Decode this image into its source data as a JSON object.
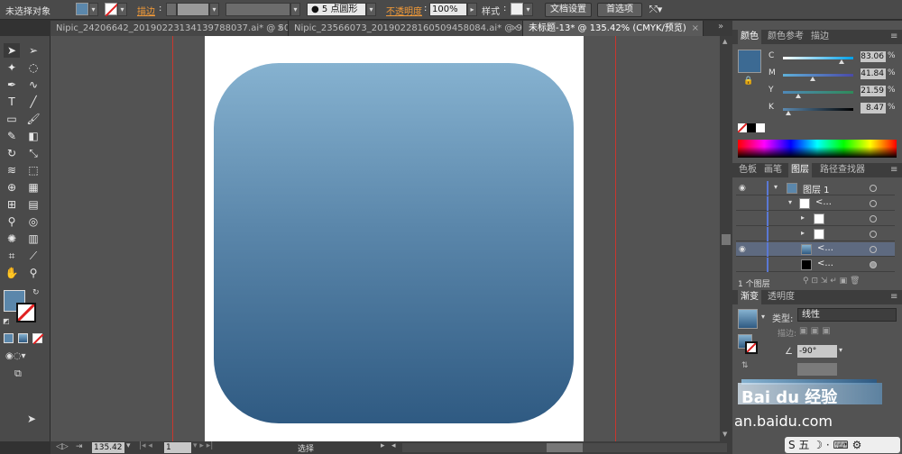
{
  "controlbar": {
    "selection_label": "未选择对象",
    "stroke_label": "描边",
    "brush_label": "● 5 点圆形",
    "opacity_label": "不透明度",
    "opacity_value": "100%",
    "style_label": "样式",
    "doc_setup_button": "文档设置",
    "prefs_button": "首选项",
    "fill_color": "#5b87ab"
  },
  "tabs": [
    {
      "label": "Nipic_24206642_20190223134139788037.ai* @ 50...",
      "active": false
    },
    {
      "label": "Nipic_23566073_20190228160509458084.ai* @ 98...",
      "active": false
    },
    {
      "label": "未标题-13* @ 135.42% (CMYK/预览)",
      "active": true
    }
  ],
  "tool_icons": [
    "select-icon",
    "direct-select-icon",
    "magic-wand-icon",
    "lasso-icon",
    "pen-icon",
    "curvature-icon",
    "type-icon",
    "line-icon",
    "rectangle-icon",
    "paintbrush-icon",
    "pencil-icon",
    "eraser-icon",
    "rotate-icon",
    "scale-icon",
    "warp-icon",
    "free-transform-icon",
    "shape-builder-icon",
    "perspective-icon",
    "mesh-icon",
    "gradient-icon",
    "eyedropper-icon",
    "blend-icon",
    "symbol-sprayer-icon",
    "column-graph-icon",
    "artboard-icon",
    "slice-icon",
    "hand-icon",
    "zoom-icon"
  ],
  "color_panel": {
    "tabs": [
      "颜色",
      "颜色参考",
      "描边"
    ],
    "current_color": "#3c6a93",
    "channels": [
      {
        "name": "C",
        "value": "83.06",
        "position": 0.83,
        "gradient": "linear-gradient(to right,#fff,#00a0e9)"
      },
      {
        "name": "M",
        "value": "41.84",
        "position": 0.42,
        "gradient": "linear-gradient(to right,#5fb0d8,#4a4aa8)"
      },
      {
        "name": "Y",
        "value": "21.59",
        "position": 0.22,
        "gradient": "linear-gradient(to right,#4f88b8,#2f8a5a)"
      },
      {
        "name": "K",
        "value": "8.47",
        "position": 0.08,
        "gradient": "linear-gradient(to right,#5c8ab0,#000)"
      }
    ],
    "unit": "%"
  },
  "layers_panel": {
    "tabs": [
      "色板",
      "画笔",
      "图层",
      "路径查找器"
    ],
    "rows": [
      {
        "name": "图层 1",
        "indent": 0,
        "visible": true,
        "thumb": "#5b87ab"
      },
      {
        "name": "<...",
        "indent": 1,
        "visible": false,
        "thumb": "#ffffff"
      },
      {
        "name": "",
        "indent": 2,
        "visible": false,
        "thumb": "#ffffff"
      },
      {
        "name": "",
        "indent": 2,
        "visible": false,
        "thumb": "#ffffff"
      },
      {
        "name": "<...",
        "indent": 2,
        "visible": true,
        "thumb": "#5b87ab"
      },
      {
        "name": "<...",
        "indent": 2,
        "visible": false,
        "thumb": "#000000"
      }
    ],
    "footer": "1 个图层"
  },
  "gradient_panel": {
    "tabs": [
      "渐变",
      "透明度"
    ],
    "type_label": "类型:",
    "type_value": "线性",
    "stroke_label": "描边:",
    "angle": "-90°"
  },
  "statusbar": {
    "zoom": "135.42",
    "page": "1",
    "tool": "选择"
  },
  "watermark": {
    "text": "Bai du 经验",
    "url": "an.baidu.com",
    "ime": "S 五 ☽ · ⌨ ⚙"
  }
}
